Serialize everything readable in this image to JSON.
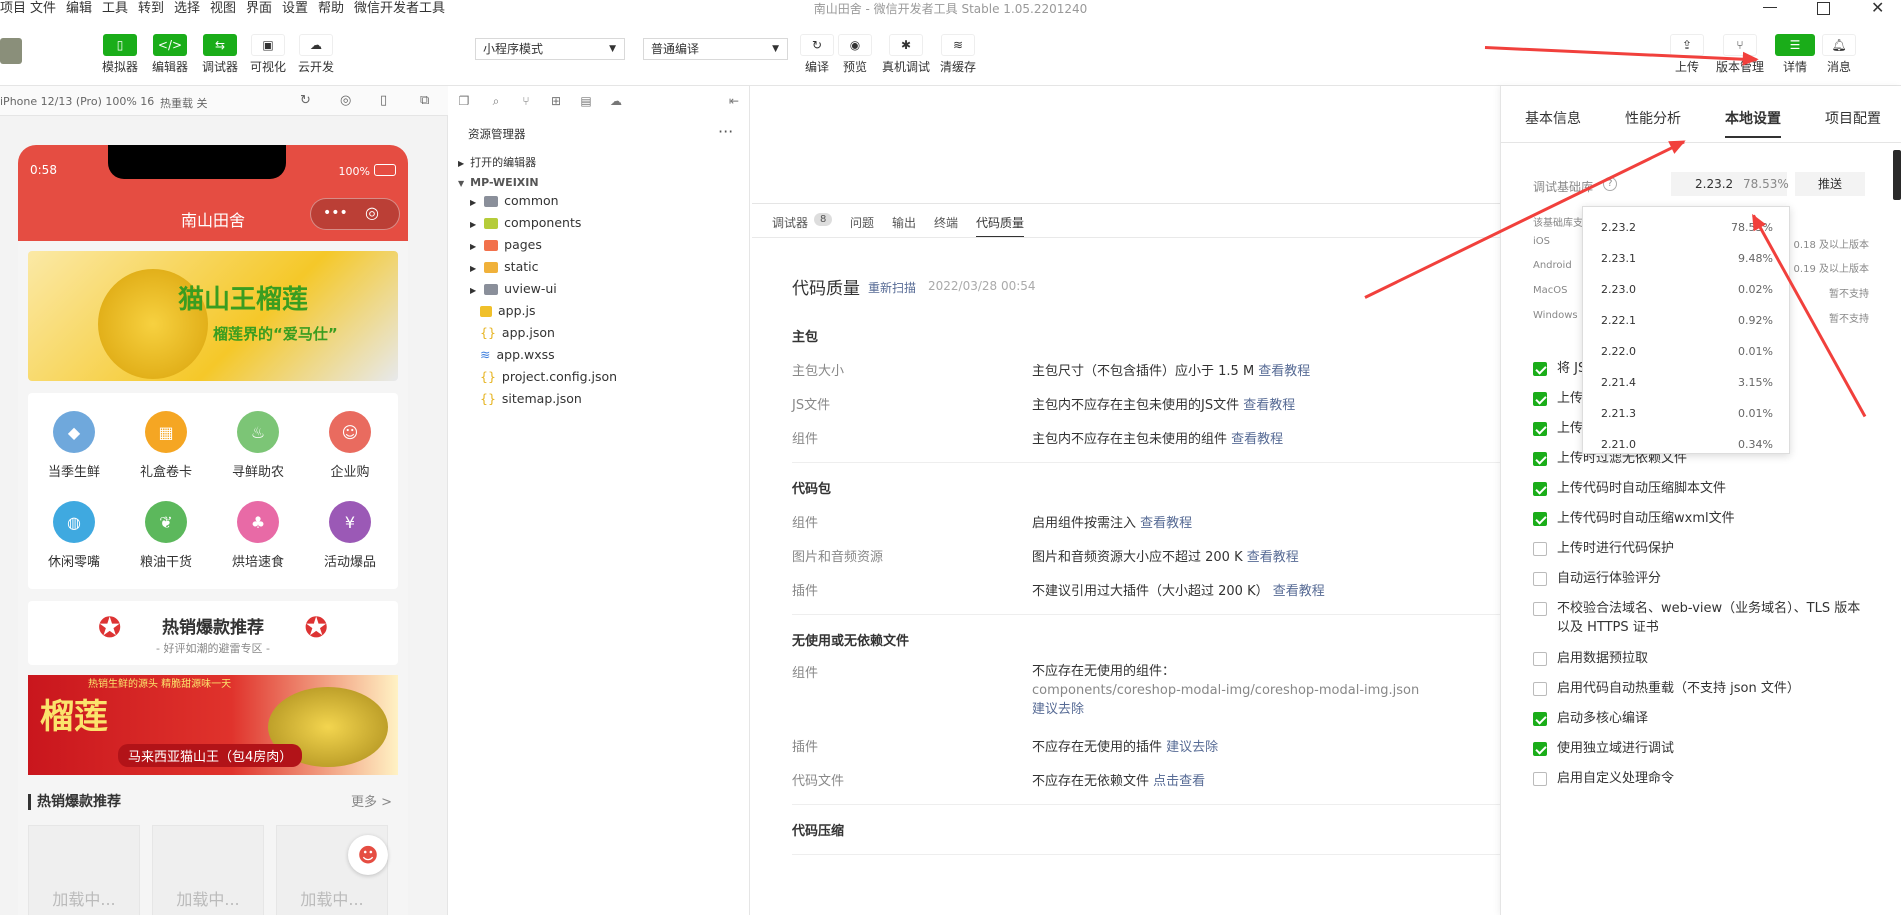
{
  "menubar": {
    "items": [
      "项目",
      "文件",
      "编辑",
      "工具",
      "转到",
      "选择",
      "视图",
      "界面",
      "设置",
      "帮助",
      "微信开发者工具"
    ],
    "app_title": "南山田舍 - 微信开发者工具 Stable 1.05.2201240"
  },
  "toolbar": {
    "left_buttons": [
      "模拟器",
      "编辑器",
      "调试器",
      "可视化",
      "云开发"
    ],
    "mode_select": "小程序模式",
    "compile_select": "普通编译",
    "mid_buttons": [
      "编译",
      "预览",
      "真机调试",
      "清缓存"
    ],
    "right_buttons": [
      "上传",
      "版本管理",
      "详情",
      "消息"
    ]
  },
  "simulator": {
    "device": "iPhone 12/13 (Pro) 100% 16",
    "hot_reload": "热重载 关",
    "status_time": "0:58",
    "battery": "100%",
    "nav_title": "南山田舍",
    "banner_title": "猫山王榴莲",
    "banner_sub": "榴莲界的“爱马仕”",
    "categories": [
      "当季生鲜",
      "礼盒卷卡",
      "寻鲜助农",
      "企业购",
      "休闲零嘴",
      "粮油干货",
      "烘培速食",
      "活动爆品"
    ],
    "hot_title": "热销爆款推荐",
    "hot_sub": "- 好评如潮的避雷专区 -",
    "promo_top": "热销生鲜的源头 精脆甜源味一天",
    "promo_big": "榴莲",
    "promo_tag": "马来西亚猫山王（包4房肉）",
    "list_title": "热销爆款推荐",
    "list_more": "更多 >",
    "loading": [
      "加载中...",
      "加载中...",
      "加载中..."
    ]
  },
  "filetree": {
    "title": "资源管理器",
    "open_editors": "打开的编辑器",
    "project": "MP-WEIXIN",
    "folders": [
      "common",
      "components",
      "pages",
      "static",
      "uview-ui"
    ],
    "files": [
      "app.js",
      "app.json",
      "app.wxss",
      "project.config.json",
      "sitemap.json"
    ]
  },
  "debug_tabs": {
    "items": [
      "调试器",
      "问题",
      "输出",
      "终端",
      "代码质量"
    ],
    "badge": "8"
  },
  "code_quality": {
    "title": "代码质量",
    "rescan": "重新扫描",
    "date": "2022/03/28 00:54",
    "main_pkg": "主包",
    "rows_main": [
      {
        "k": "主包大小",
        "v": "主包尺寸（不包含插件）应小于 1.5 M",
        "l": "查看教程"
      },
      {
        "k": "JS文件",
        "v": "主包内不应存在主包未使用的JS文件",
        "l": "查看教程"
      },
      {
        "k": "组件",
        "v": "主包内不应存在主包未使用的组件",
        "l": "查看教程"
      }
    ],
    "code_pkg": "代码包",
    "rows_code": [
      {
        "k": "组件",
        "v": "启用组件按需注入",
        "l": "查看教程"
      },
      {
        "k": "图片和音频资源",
        "v": "图片和音频资源大小应不超过 200 K",
        "l": "查看教程"
      },
      {
        "k": "插件",
        "v": "不建议引用过大插件（大小超过 200 K）",
        "l": "查看教程"
      }
    ],
    "unused": "无使用或无依赖文件",
    "unused_comp_k": "组件",
    "unused_comp_v": "不应存在无使用的组件：",
    "unused_comp_path": "components/coreshop-modal-img/coreshop-modal-img.json",
    "unused_comp_l": "建议去除",
    "unused_plugin_k": "插件",
    "unused_plugin_v": "不应存在无使用的插件",
    "unused_plugin_l": "建议去除",
    "unused_code_k": "代码文件",
    "unused_code_v": "不应存在无依赖文件",
    "unused_code_l": "点击查看",
    "compress": "代码压缩"
  },
  "right_panel": {
    "tabs": [
      "基本信息",
      "性能分析",
      "本地设置",
      "项目配置"
    ],
    "active_tab": "本地设置",
    "lib_label": "调试基础库",
    "lib_version": "2.23.2",
    "lib_percent": "78.53%",
    "push": "推送",
    "coverage_label": "该基础库支",
    "platforms": [
      {
        "name": "iOS",
        "val": "0.18 及以上版本"
      },
      {
        "name": "Android",
        "val": "0.19 及以上版本"
      },
      {
        "name": "MacOS",
        "val": "暂不支持"
      },
      {
        "name": "Windows",
        "val": "暂不支持"
      }
    ],
    "dropdown": [
      {
        "v": "2.23.2",
        "p": "78.53%"
      },
      {
        "v": "2.23.1",
        "p": "9.48%"
      },
      {
        "v": "2.23.0",
        "p": "0.02%"
      },
      {
        "v": "2.22.1",
        "p": "0.92%"
      },
      {
        "v": "2.22.0",
        "p": "0.01%"
      },
      {
        "v": "2.21.4",
        "p": "3.15%"
      },
      {
        "v": "2.21.3",
        "p": "0.01%"
      },
      {
        "v": "2.21.0",
        "p": "0.34%"
      }
    ],
    "options": [
      {
        "t": "将 JS",
        "on": true
      },
      {
        "t": "上传",
        "on": true
      },
      {
        "t": "上传",
        "on": true
      },
      {
        "t": "上传时过滤无依赖文件",
        "on": true
      },
      {
        "t": "上传代码时自动压缩脚本文件",
        "on": true
      },
      {
        "t": "上传代码时自动压缩wxml文件",
        "on": true
      },
      {
        "t": "上传时进行代码保护",
        "on": false
      },
      {
        "t": "自动运行体验评分",
        "on": false
      },
      {
        "t": "不校验合法域名、web-view（业务域名）、TLS 版本以及 HTTPS 证书",
        "on": false
      },
      {
        "t": "启用数据预拉取",
        "on": false
      },
      {
        "t": "启用代码自动热重载（不支持 json 文件）",
        "on": false
      },
      {
        "t": "启动多核心编译",
        "on": true
      },
      {
        "t": "使用独立域进行调试",
        "on": true
      },
      {
        "t": "启用自定义处理命令",
        "on": false
      }
    ]
  },
  "colors": {
    "accent_green": "#1aad19",
    "brand_red": "#e54d42",
    "link": "#576b95",
    "arrow_red": "#f1403c"
  }
}
